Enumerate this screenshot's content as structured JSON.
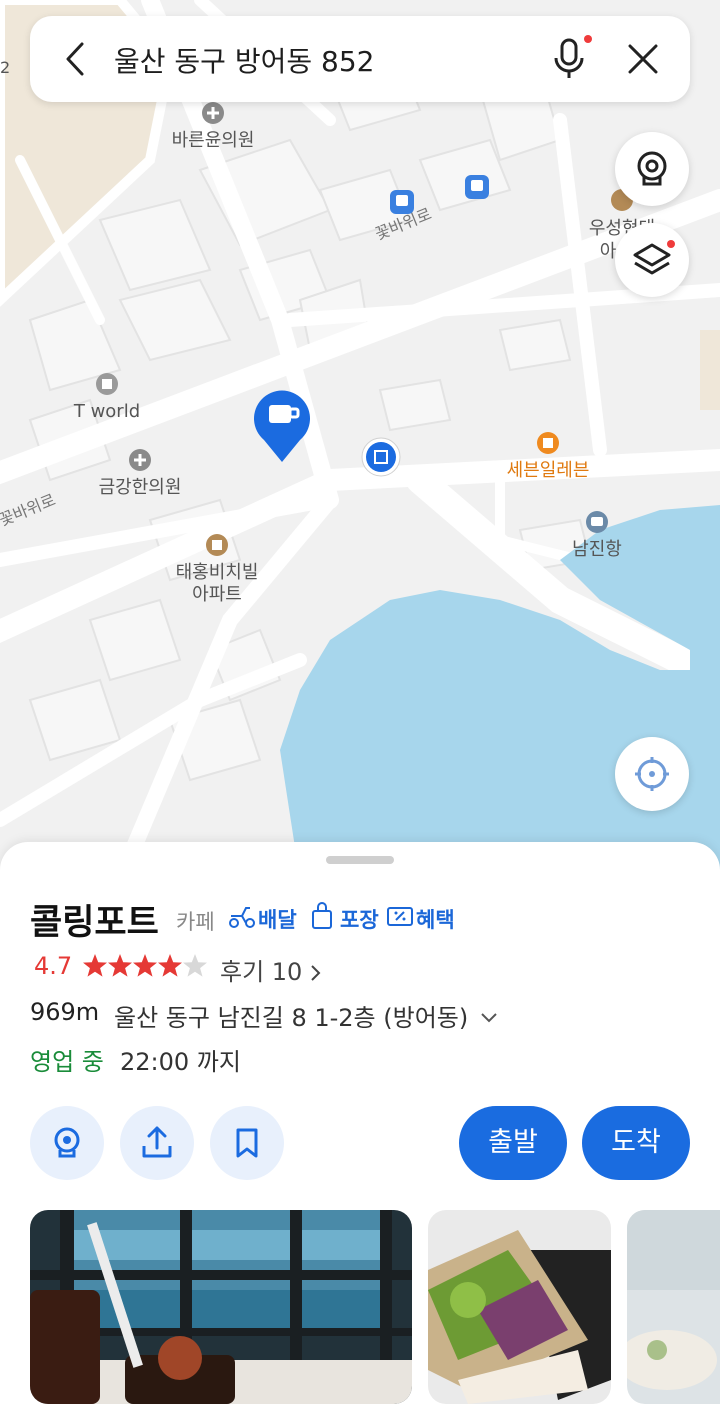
{
  "search": {
    "query": "울산 동구 방어동 852"
  },
  "map": {
    "labels": {
      "clinic1": "바른윤의원",
      "road1": "꽃바위로",
      "road2": "꽃바위로",
      "apt_top_a": "우성현대",
      "apt_top_b": "아",
      "tworld": "T world",
      "clinic2": "금강한의원",
      "seven": "세븐일레븐",
      "harbor": "남진항",
      "apt_a": "태홍비치빌",
      "apt_b": "아파트",
      "edge_num": "2"
    }
  },
  "place": {
    "name": "콜링포트",
    "category": "카페",
    "tags": {
      "delivery": "배달",
      "takeout": "포장",
      "benefit": "혜택"
    },
    "rating": "4.7",
    "reviews": "후기 10",
    "distance": "969m",
    "address": "울산 동구 남진길 8 1-2층 (방어동)",
    "status": "영업 중",
    "hours": "22:00 까지",
    "depart_label": "출발",
    "arrive_label": "도착"
  },
  "colors": {
    "accent": "#1a6ce0",
    "water": "#a7d6ec",
    "open": "#1a8c3a",
    "rating": "#e53935"
  }
}
